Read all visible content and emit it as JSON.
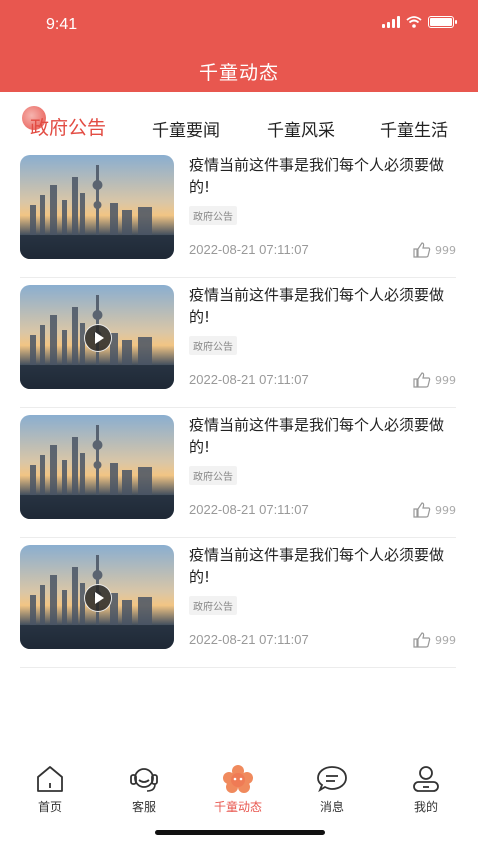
{
  "status_bar": {
    "time": "9:41"
  },
  "header": {
    "title": "千童动态"
  },
  "tabs": [
    {
      "label": "政府公告",
      "active": true
    },
    {
      "label": "千童要闻",
      "active": false
    },
    {
      "label": "千童风采",
      "active": false
    },
    {
      "label": "千童生活",
      "active": false
    }
  ],
  "articles": [
    {
      "title": "疫情当前这件事是我们每个人必须要做的!",
      "tag": "政府公告",
      "date": "2022-08-21   07:11:07",
      "likes": "999",
      "video": false
    },
    {
      "title": "疫情当前这件事是我们每个人必须要做的!",
      "tag": "政府公告",
      "date": "2022-08-21   07:11:07",
      "likes": "999",
      "video": true
    },
    {
      "title": "疫情当前这件事是我们每个人必须要做的!",
      "tag": "政府公告",
      "date": "2022-08-21   07:11:07",
      "likes": "999",
      "video": false
    },
    {
      "title": "疫情当前这件事是我们每个人必须要做的!",
      "tag": "政府公告",
      "date": "2022-08-21   07:11:07",
      "likes": "999",
      "video": true
    }
  ],
  "tabbar": [
    {
      "label": "首页",
      "icon": "home-icon",
      "active": false
    },
    {
      "label": "客服",
      "icon": "headset-icon",
      "active": false
    },
    {
      "label": "千童动态",
      "icon": "flower-icon",
      "active": true
    },
    {
      "label": "消息",
      "icon": "chat-icon",
      "active": false
    },
    {
      "label": "我的",
      "icon": "user-icon",
      "active": false
    }
  ],
  "colors": {
    "accent": "#e8574f",
    "active_tab": "#e24c43"
  }
}
